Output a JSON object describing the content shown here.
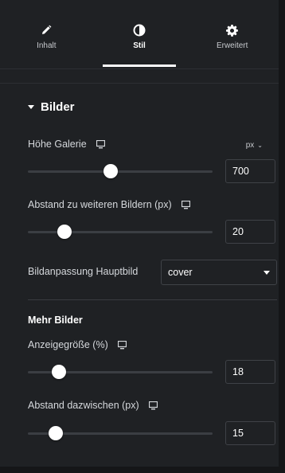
{
  "tabs": [
    {
      "label": "Inhalt",
      "icon": "pencil-icon",
      "active": false
    },
    {
      "label": "Stil",
      "icon": "half-circle-icon",
      "active": true
    },
    {
      "label": "Erweitert",
      "icon": "gear-icon",
      "active": false
    }
  ],
  "section": {
    "title": "Bilder",
    "expanded": true
  },
  "controls": {
    "hoehe_galerie": {
      "label": "Höhe Galerie",
      "unit": "px",
      "value": "700",
      "slider_fraction": 0.45
    },
    "abstand_bildern": {
      "label": "Abstand zu weiteren Bildern (px)",
      "value": "20",
      "slider_fraction": 0.2
    },
    "bildanpassung": {
      "label": "Bildanpassung Hauptbild",
      "selected": "cover"
    }
  },
  "mehr_bilder": {
    "title": "Mehr Bilder",
    "anzeigegroesse": {
      "label": "Anzeigegröße (%)",
      "value": "18",
      "slider_fraction": 0.17
    },
    "abstand_dazwischen": {
      "label": "Abstand dazwischen (px)",
      "value": "15",
      "slider_fraction": 0.15
    }
  },
  "colors": {
    "panel_bg": "#1f2124",
    "text": "#d5d8dc",
    "accent": "#ffffff",
    "track": "#3b3e43"
  }
}
